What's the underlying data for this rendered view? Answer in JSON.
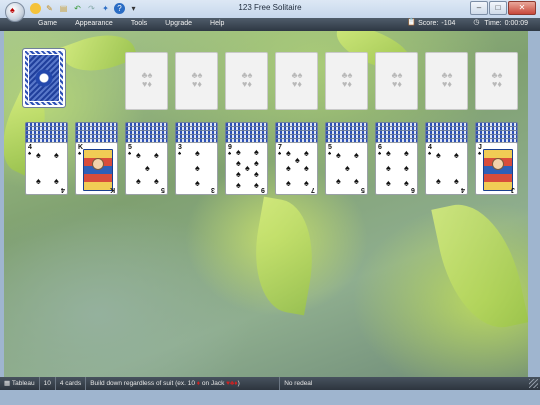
{
  "window": {
    "title": "123 Free Solitaire"
  },
  "menu": [
    "Game",
    "Appearance",
    "Tools",
    "Upgrade",
    "Help"
  ],
  "stats": {
    "score_label": "Score:",
    "score_value": "-104",
    "time_label": "Time:",
    "time_value": "0:00:09"
  },
  "colors": {
    "card_back": "#2b4fb4",
    "menubar": "#3a4551",
    "felt": "#8fae78",
    "suit_black": "#111111",
    "suit_red": "#cc2222"
  },
  "stock": {
    "label": "stock-pile"
  },
  "foundations": [
    {
      "suits": "♣♠ ♥♦"
    },
    {
      "suits": "♣♠ ♥♦"
    },
    {
      "suits": "♣♠ ♥♦"
    },
    {
      "suits": "♣♠ ♥♦"
    },
    {
      "suits": "♣♠ ♥♦"
    },
    {
      "suits": "♣♠ ♥♦"
    },
    {
      "suits": "♣♠ ♥♦"
    },
    {
      "suits": "♣♠ ♥♦"
    }
  ],
  "tableau": [
    {
      "rank": "4",
      "suit": "♠",
      "court": false
    },
    {
      "rank": "K",
      "suit": "♠",
      "court": true
    },
    {
      "rank": "5",
      "suit": "♠",
      "court": false
    },
    {
      "rank": "3",
      "suit": "♠",
      "court": false
    },
    {
      "rank": "9",
      "suit": "♠",
      "court": false
    },
    {
      "rank": "7",
      "suit": "♠",
      "court": false
    },
    {
      "rank": "5",
      "suit": "♠",
      "court": false
    },
    {
      "rank": "6",
      "suit": "♠",
      "court": false
    },
    {
      "rank": "4",
      "suit": "♠",
      "court": false
    },
    {
      "rank": "J",
      "suit": "♠",
      "court": true
    }
  ],
  "status": {
    "area": "Tableau",
    "piles": "10",
    "cards": "4 cards",
    "rule_prefix": "Build down regardless of suit (ex. 10",
    "rule_mid": "on Jack",
    "rule_suffix": ")",
    "redeal": "No redeal"
  }
}
